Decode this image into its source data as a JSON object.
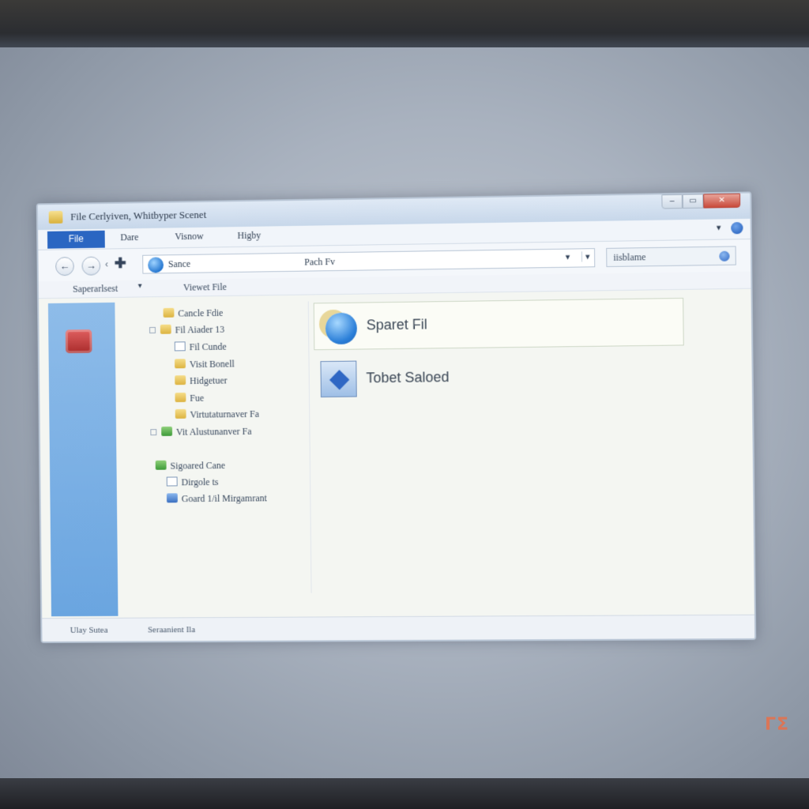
{
  "window": {
    "title": "File Cerlyiven, Whitbyper Scenet",
    "controls": {
      "minimize": "–",
      "maximize": "▭",
      "close": "✕"
    }
  },
  "ribbon": {
    "tabs": [
      "File",
      "Dare",
      "Visnow",
      "Higby"
    ]
  },
  "nav": {
    "back_icon": "←",
    "forward_icon": "→",
    "separator": "‹",
    "up_icon": "✚",
    "address": "Sance",
    "path": "Pach Fv",
    "dropdown": "▾",
    "search_value": "iisblame"
  },
  "toolbar": {
    "left_label": "Saperarlsest",
    "left_caret": "▾",
    "right_label": "Viewet File"
  },
  "tree": {
    "items": [
      {
        "label": "Cancle Fdie",
        "icon": "folder-icon"
      },
      {
        "label": "Fil Aiader 13",
        "icon": "folder-icon"
      },
      {
        "label": "Fil Cunde",
        "icon": "document-icon"
      },
      {
        "label": "Visit Bonell",
        "icon": "folder-icon"
      },
      {
        "label": "Hidgetuer",
        "icon": "folder-icon"
      },
      {
        "label": "Fue",
        "icon": "folder-icon"
      },
      {
        "label": "Virtutaturnaver Fa",
        "icon": "folder-icon"
      },
      {
        "label": "Vit Alustunanver Fa",
        "icon": "green-icon"
      },
      {
        "label": "Sigoared Cane",
        "icon": "network-icon"
      },
      {
        "label": "Dirgole ts",
        "icon": "document-icon"
      },
      {
        "label": "Goard 1/il Mirgamrant",
        "icon": "blue-icon"
      }
    ]
  },
  "content": {
    "items": [
      {
        "label": "Sparet Fil",
        "icon": "globe-icon"
      },
      {
        "label": "Tobet Saloed",
        "icon": "image-icon"
      }
    ]
  },
  "status": {
    "left": "Ulay Sutea",
    "right": "Seraanient Ila"
  },
  "bezel": {
    "logo": "ΓΣ"
  },
  "colors": {
    "accent": "#2a66c2",
    "side_panel": "#7db2e6",
    "close_button": "#c84a3b"
  }
}
